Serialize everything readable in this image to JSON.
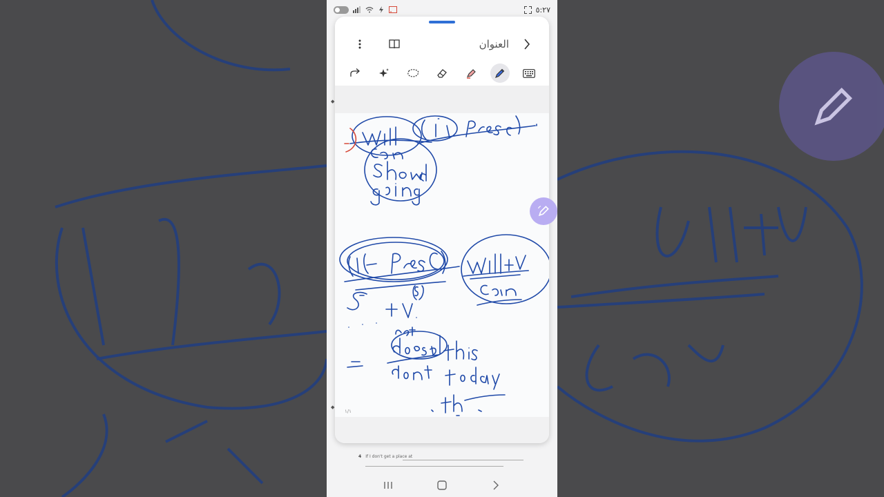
{
  "status_bar": {
    "time": "٥:٢٧"
  },
  "header": {
    "title": "العنوان"
  },
  "toolbar": {
    "tools": [
      "redo-icon",
      "ai-sparkle-icon",
      "lasso-icon",
      "eraser-icon",
      "highlighter-icon",
      "pen-icon",
      "keyboard-icon"
    ],
    "active_tool": "pen"
  },
  "page": {
    "number": "١/١"
  },
  "background_document": {
    "lines": [
      {
        "num": "4",
        "text": "If I don't get a place at"
      }
    ]
  },
  "colors": {
    "ink": "#1f49a8",
    "accent": "#2f6fd6",
    "fab": "#b9adf2",
    "red_ink": "#d64a3a"
  }
}
